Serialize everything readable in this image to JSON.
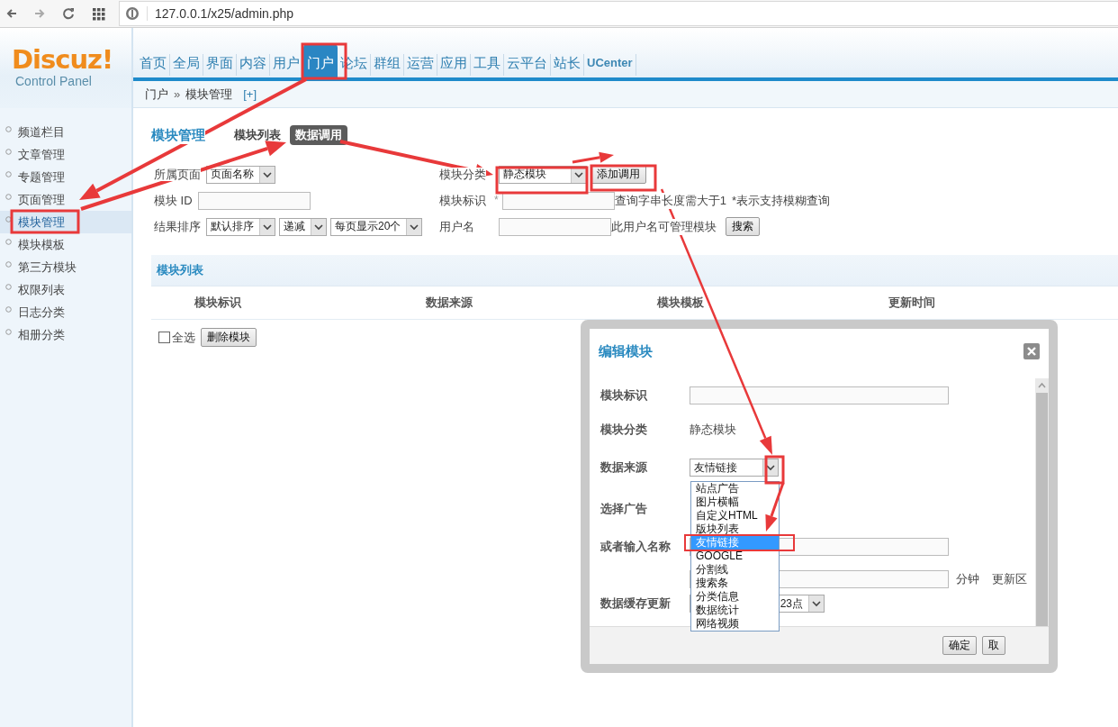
{
  "browser": {
    "url": "127.0.0.1/x25/admin.php"
  },
  "logo": {
    "name": "Discuz!",
    "subtitle": "Control Panel"
  },
  "nav": [
    {
      "label": "首页",
      "selected": false
    },
    {
      "label": "全局",
      "selected": false
    },
    {
      "label": "界面",
      "selected": false
    },
    {
      "label": "内容",
      "selected": false
    },
    {
      "label": "用户",
      "selected": false
    },
    {
      "label": "门户",
      "selected": true
    },
    {
      "label": "论坛",
      "selected": false
    },
    {
      "label": "群组",
      "selected": false
    },
    {
      "label": "运营",
      "selected": false
    },
    {
      "label": "应用",
      "selected": false
    },
    {
      "label": "工具",
      "selected": false
    },
    {
      "label": "云平台",
      "selected": false
    },
    {
      "label": "站长",
      "selected": false
    },
    {
      "label": "UCenter",
      "selected": false
    }
  ],
  "breadcrumb": {
    "items": [
      "门户",
      "模块管理"
    ],
    "separator": "»",
    "add": "[+]"
  },
  "sidebar": {
    "items": [
      {
        "label": "频道栏目",
        "selected": false
      },
      {
        "label": "文章管理",
        "selected": false
      },
      {
        "label": "专题管理",
        "selected": false
      },
      {
        "label": "页面管理",
        "selected": false
      },
      {
        "label": "模块管理",
        "selected": true
      },
      {
        "label": "模块模板",
        "selected": false
      },
      {
        "label": "第三方模块",
        "selected": false
      },
      {
        "label": "权限列表",
        "selected": false
      },
      {
        "label": "日志分类",
        "selected": false
      },
      {
        "label": "相册分类",
        "selected": false
      }
    ]
  },
  "page": {
    "title": "模块管理",
    "tabs": [
      {
        "label": "模块列表",
        "selected": false
      },
      {
        "label": "数据调用",
        "selected": true
      }
    ]
  },
  "filters": [
    {
      "left": [
        {
          "kind": "label",
          "text": "所属页面"
        },
        {
          "kind": "select",
          "text": "页面名称"
        }
      ],
      "right": [
        {
          "kind": "label",
          "text": "模块分类"
        },
        {
          "kind": "select",
          "text": "静态模块"
        },
        {
          "kind": "button",
          "text": "添加调用"
        }
      ]
    },
    {
      "left": [
        {
          "kind": "label",
          "text": "模块 ID"
        },
        {
          "kind": "input"
        }
      ],
      "right": [
        {
          "kind": "label",
          "text": "模块标识"
        },
        {
          "kind": "mark",
          "text": "*"
        },
        {
          "kind": "input"
        },
        {
          "kind": "note",
          "text": "查询字串长度需大于1"
        },
        {
          "kind": "note",
          "text": "*表示支持模糊查询"
        }
      ]
    },
    {
      "left": [
        {
          "kind": "label",
          "text": "结果排序"
        },
        {
          "kind": "select",
          "text": "默认排序"
        },
        {
          "kind": "select",
          "text": "递减"
        },
        {
          "kind": "select",
          "text": "每页显示20个"
        }
      ],
      "right": [
        {
          "kind": "label",
          "text": "用户名"
        },
        {
          "kind": "input"
        },
        {
          "kind": "note",
          "text": "此用户名可管理模块"
        },
        {
          "kind": "button",
          "text": "搜索"
        }
      ]
    }
  ],
  "list": {
    "title": "模块列表",
    "columns": [
      "模块标识",
      "数据来源",
      "模块模板",
      "更新时间"
    ],
    "select_all": {
      "label": "全选",
      "checked": false
    },
    "delete_button": "删除模块"
  },
  "dialog": {
    "title": "编辑模块",
    "rows": [
      {
        "label": "模块标识",
        "kind": "input"
      },
      {
        "label": "模块分类",
        "kind": "text",
        "value": "静态模块"
      },
      {
        "label": "数据来源",
        "kind": "select",
        "value": "友情链接"
      },
      {
        "label": "选择广告",
        "kind": "empty"
      },
      {
        "label": "或者输入名称",
        "kind": "input"
      },
      {
        "kind": "interval",
        "unit": "分钟",
        "after": "更新区"
      },
      {
        "label": "数据缓存更新",
        "kind": "select_right",
        "value": "23点"
      }
    ],
    "options": [
      {
        "label": "站点广告",
        "selected": false
      },
      {
        "label": "图片横幅",
        "selected": false
      },
      {
        "label": "自定义HTML",
        "selected": false
      },
      {
        "label": "版块列表",
        "selected": false
      },
      {
        "label": "友情链接",
        "selected": true
      },
      {
        "label": "GOOGLE",
        "selected": false
      },
      {
        "label": "分割线",
        "selected": false
      },
      {
        "label": "搜索条",
        "selected": false
      },
      {
        "label": "分类信息",
        "selected": false
      },
      {
        "label": "数据统计",
        "selected": false
      },
      {
        "label": "网络视频",
        "selected": false
      }
    ],
    "buttons": [
      "确定",
      "取"
    ]
  }
}
